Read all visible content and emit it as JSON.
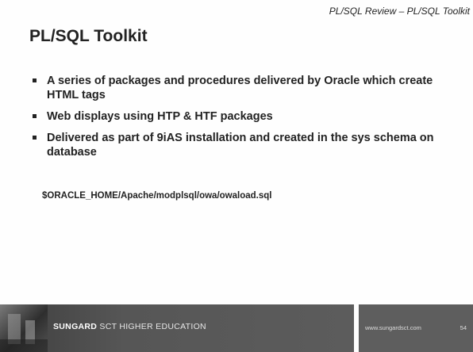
{
  "header": {
    "subtitle": "PL/SQL  Review – PL/SQL Toolkit"
  },
  "title": "PL/SQL Toolkit",
  "bullets": [
    "A series of packages and procedures delivered by Oracle which create HTML tags",
    "Web displays using HTP & HTF packages",
    "Delivered as part of 9iAS installation and created in the sys schema on database"
  ],
  "code_path": "$ORACLE_HOME/Apache/modplsql/owa/owaload.sql",
  "footer": {
    "brand_bold": "SUNGARD",
    "brand_rest": "SCT HIGHER EDUCATION",
    "url": "www.sungardsct.com",
    "page_number": "54"
  }
}
